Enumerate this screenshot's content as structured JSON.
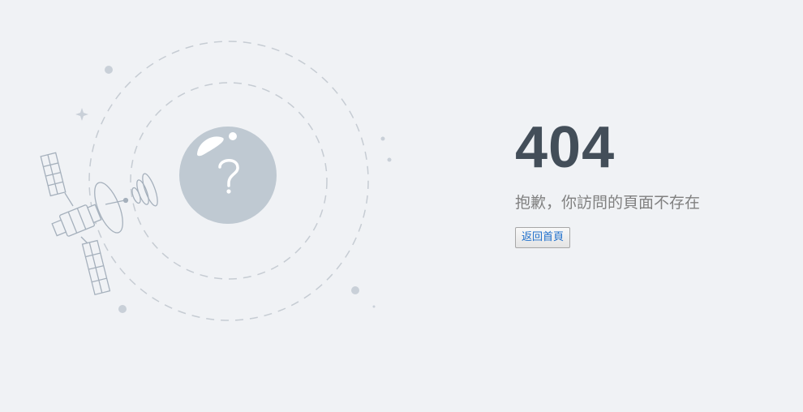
{
  "error": {
    "code": "404",
    "message": "抱歉，你訪問的頁面不存在"
  },
  "actions": {
    "home_label": "返回首頁"
  },
  "colors": {
    "background": "#f0f2f5",
    "code_text": "#434e59",
    "message_text": "#808080",
    "link_blue": "#1e6fcc",
    "illustration_gray": "#bfc9d2"
  },
  "icons": {
    "satellite": "satellite-icon",
    "question": "question-mark-icon"
  }
}
